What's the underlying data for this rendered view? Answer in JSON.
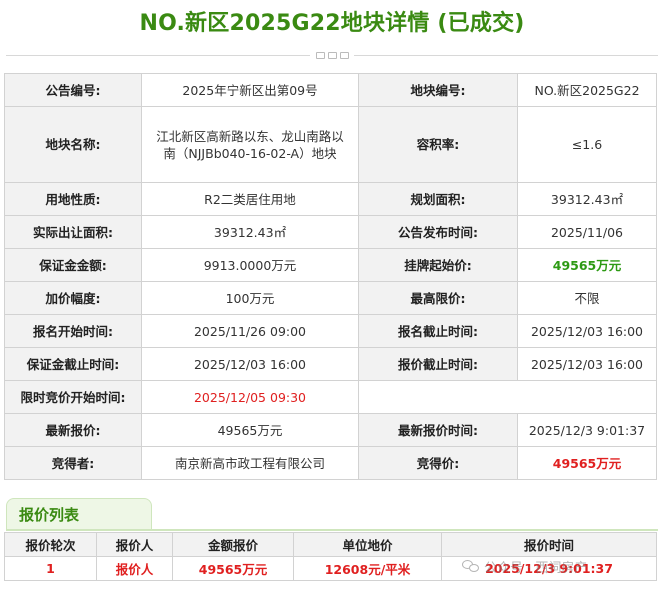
{
  "header": {
    "title": "NO.新区2025G22地块详情 (已成交)"
  },
  "details": {
    "announcement_no_label": "公告编号:",
    "announcement_no": "2025年宁新区出第09号",
    "plot_no_label": "地块编号:",
    "plot_no": "NO.新区2025G22",
    "plot_name_label": "地块名称:",
    "plot_name": "江北新区高新路以东、龙山南路以南（NJJBb040-16-02-A）地块",
    "far_label": "容积率:",
    "far": "≤1.6",
    "land_use_label": "用地性质:",
    "land_use": "R2二类居住用地",
    "planned_area_label": "规划面积:",
    "planned_area": "39312.43㎡",
    "actual_area_label": "实际出让面积:",
    "actual_area": "39312.43㎡",
    "publish_time_label": "公告发布时间:",
    "publish_time": "2025/11/06",
    "deposit_label": "保证金金额:",
    "deposit": "9913.0000万元",
    "start_price_label": "挂牌起始价:",
    "start_price": "49565万元",
    "increment_label": "加价幅度:",
    "increment": "100万元",
    "max_price_label": "最高限价:",
    "max_price": "不限",
    "reg_start_label": "报名开始时间:",
    "reg_start": "2025/11/26 09:00",
    "reg_end_label": "报名截止时间:",
    "reg_end": "2025/12/03 16:00",
    "deposit_deadline_label": "保证金截止时间:",
    "deposit_deadline": "2025/12/03 16:00",
    "quote_deadline_label": "报价截止时间:",
    "quote_deadline": "2025/12/03 16:00",
    "timed_bid_start_label": "限时竞价开始时间:",
    "timed_bid_start": "2025/12/05 09:30",
    "latest_quote_label": "最新报价:",
    "latest_quote": "49565万元",
    "latest_quote_time_label": "最新报价时间:",
    "latest_quote_time": "2025/12/3 9:01:37",
    "winner_label": "竞得者:",
    "winner": "南京新高市政工程有限公司",
    "winning_price_label": "竞得价:",
    "winning_price": "49565万元"
  },
  "bid_list": {
    "tab_label": "报价列表",
    "columns": [
      "报价轮次",
      "报价人",
      "金额报价",
      "单位地价",
      "报价时间"
    ],
    "rows": [
      {
        "round": "1",
        "bidder": "报价人",
        "amount": "49565万元",
        "unit_price": "12608元/平米",
        "time": "2025/12/3 9:01:37"
      }
    ]
  },
  "watermark": {
    "text": "公众号 · 西祠房产"
  },
  "colors": {
    "title_green": "#3a8a12",
    "accent_green": "#2d9a14",
    "alert_red": "#e02020",
    "label_bg": "#f2f2f2"
  }
}
